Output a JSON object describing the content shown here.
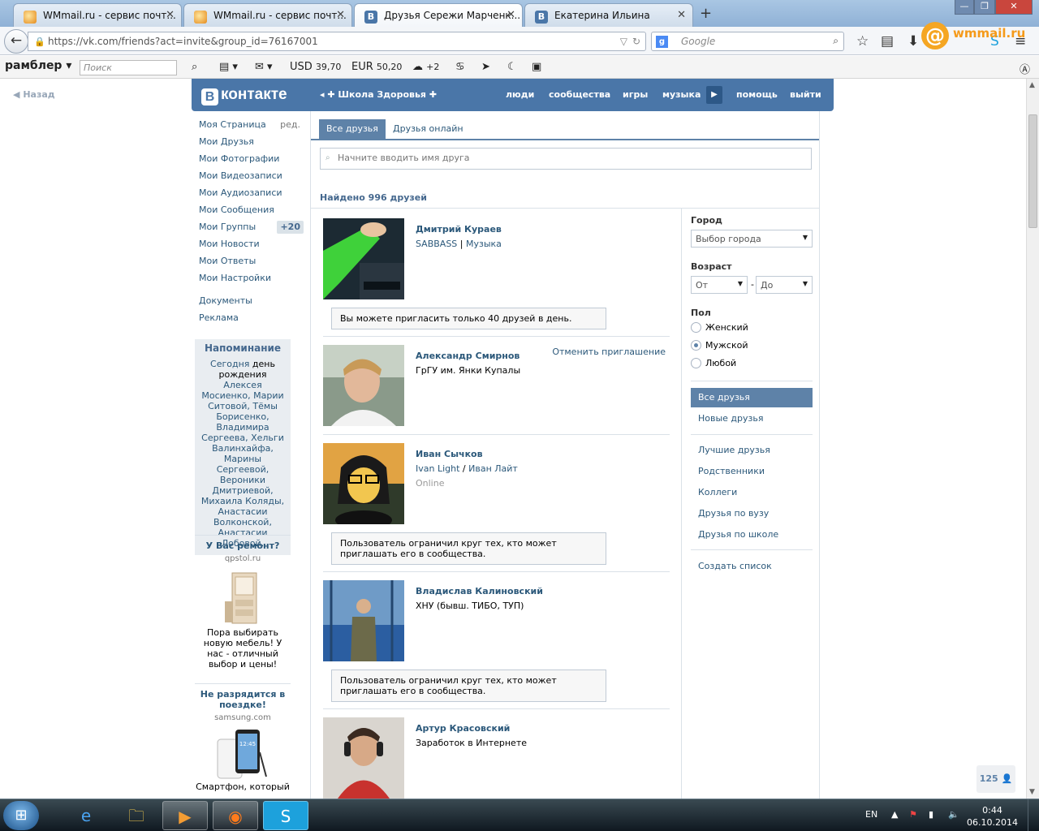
{
  "browser": {
    "tabs": [
      {
        "title": "WMmail.ru - сервис почт...",
        "icon": "wmmail-icon",
        "active": false
      },
      {
        "title": "WMmail.ru - сервис почт...",
        "icon": "wmmail-icon",
        "active": false
      },
      {
        "title": "Друзья Сережи Марченк...",
        "icon": "vk-icon",
        "active": true
      },
      {
        "title": "Екатерина Ильина",
        "icon": "vk-icon",
        "active": false
      }
    ],
    "url": "https://vk.com/friends?act=invite&group_id=76167001",
    "search_placeholder": "Google",
    "wm_logo_text": "wmmail.ru"
  },
  "rambler_bar": {
    "brand": "рамблер",
    "search_placeholder": "Поиск",
    "usd_label": "USD",
    "usd_value": "39,70",
    "eur_label": "EUR",
    "eur_value": "50,20",
    "weather": "+2"
  },
  "page": {
    "back": "Назад",
    "vk_logo": "контакте",
    "group_link": "Школа Здоровья",
    "nav": [
      "люди",
      "сообщества",
      "игры",
      "музыка",
      "помощь",
      "выйти"
    ],
    "left_menu": [
      {
        "label": "Моя Страница",
        "side": "ред."
      },
      {
        "label": "Мои Друзья"
      },
      {
        "label": "Мои Фотографии"
      },
      {
        "label": "Мои Видеозаписи"
      },
      {
        "label": "Мои Аудиозаписи"
      },
      {
        "label": "Мои Сообщения"
      },
      {
        "label": "Мои Группы",
        "badge": "+20"
      },
      {
        "label": "Мои Новости"
      },
      {
        "label": "Мои Ответы"
      },
      {
        "label": "Мои Настройки"
      }
    ],
    "left_menu2": [
      "Документы",
      "Реклама"
    ],
    "reminder": {
      "title": "Напоминание",
      "w1": "Сегодня",
      "w2": " день рождения ",
      "w3": "Алексея Мосиенко, Марии Ситовой, Тёмы Борисенко, Владимира Сергеева, Хельги Валинхайфа, Марины Сергеевой, Вероники Дмитриевой, Михаила Коляды, Анастасии Волконской, Анастасии Лобовой."
    },
    "ads": [
      {
        "title": "У Вас ремонт?",
        "domain": "qpstol.ru",
        "text": "Пора выбирать новую мебель! У нас - отличный выбор и цены!"
      },
      {
        "title": "Не разрядится в поездке!",
        "domain": "samsung.com",
        "text": "Смартфон, который"
      }
    ],
    "tabs": [
      "Все друзья",
      "Друзья онлайн"
    ],
    "search_placeholder": "Начните вводить имя друга",
    "found": "Найдено 996 друзей",
    "friends": [
      {
        "name": "Дмитрий Кураев",
        "l2a": "SABBASS",
        "l2sep": " | ",
        "l2b": "Музыка",
        "note": "Вы можете пригласить только 40 друзей в день."
      },
      {
        "name": "Александр Смирнов",
        "l2": "ГрГУ им. Янки Купалы",
        "action": "Отменить приглашение"
      },
      {
        "name": "Иван Сычков",
        "l2a": "Ivan Light",
        "l2sep": " / ",
        "l2b": "Иван Лайт",
        "l3": "Online",
        "note": "Пользователь ограничил круг тех, кто может приглашать его в сообщества."
      },
      {
        "name": "Владислав Калиновский",
        "l2": "ХНУ (бывш. ТИБО, ТУП)",
        "note": "Пользователь ограничил круг тех, кто может приглашать его в сообщества."
      },
      {
        "name": "Артур Красовский",
        "l2": "Заработок в Интернете"
      }
    ],
    "filter": {
      "city_label": "Город",
      "city_value": "Выбор города",
      "age_label": "Возраст",
      "age_from": "От",
      "age_dash": "-",
      "age_to": "До",
      "sex_label": "Пол",
      "sex_options": [
        "Женский",
        "Мужской",
        "Любой"
      ],
      "sex_selected": "Мужской",
      "lists": [
        "Все друзья",
        "Новые друзья"
      ],
      "lists2": [
        "Лучшие друзья",
        "Родственники",
        "Коллеги",
        "Друзья по вузу",
        "Друзья по школе"
      ],
      "create_list": "Создать список"
    },
    "online_count": "125"
  },
  "taskbar": {
    "lang": "EN",
    "time": "0:44",
    "date": "06.10.2014"
  }
}
